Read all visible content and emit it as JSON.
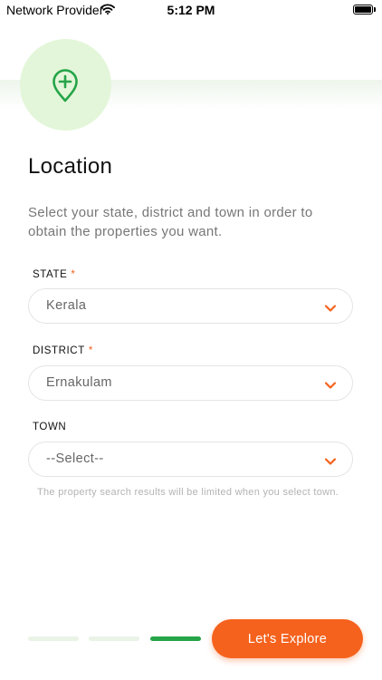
{
  "status_bar": {
    "carrier": "Network Provider",
    "time": "5:12 PM"
  },
  "page": {
    "title": "Location",
    "subtitle": "Select your state, district and town in order to obtain the properties you want."
  },
  "form": {
    "state": {
      "label": "STATE",
      "required_mark": "*",
      "value": "Kerala"
    },
    "district": {
      "label": "DISTRICT",
      "required_mark": "*",
      "value": "Ernakulam"
    },
    "town": {
      "label": "TOWN",
      "value": "--Select--"
    },
    "hint": "The property search results will be limited when you select town."
  },
  "pager": {
    "total": 3,
    "current": 3
  },
  "footer": {
    "explore_label": "Let's Explore"
  },
  "colors": {
    "accent": "#f5621d",
    "brand_green": "#26a448",
    "hero_circle": "#e3f6d9"
  },
  "icons": {
    "hero": "map-pin-plus-icon",
    "dropdown": "chevron-down-icon",
    "wifi": "wifi-icon",
    "battery": "battery-icon"
  }
}
